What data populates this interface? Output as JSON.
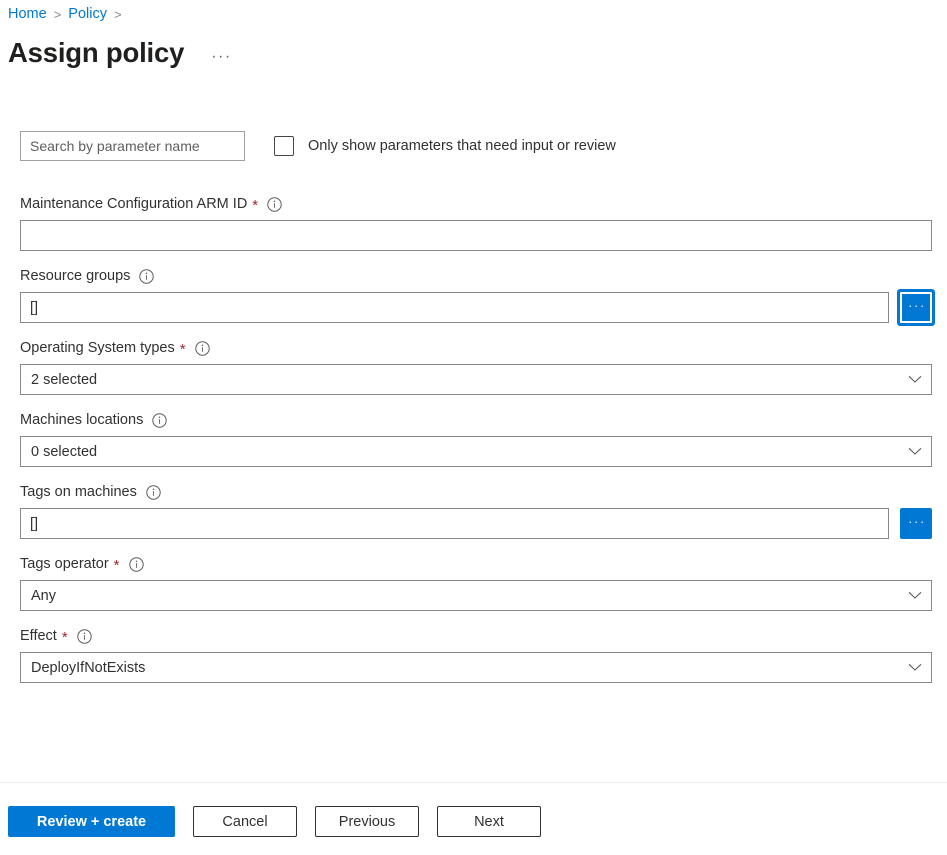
{
  "breadcrumb": {
    "items": [
      {
        "label": "Home"
      },
      {
        "label": "Policy"
      }
    ],
    "separator": ">"
  },
  "header": {
    "title": "Assign policy",
    "more_menu": "···"
  },
  "filters": {
    "search_placeholder": "Search by parameter name",
    "search_value": "",
    "checkbox_label": "Only show parameters that need input or review",
    "checkbox_checked": false
  },
  "parameters": [
    {
      "label": "Maintenance Configuration ARM ID",
      "required": true,
      "info": true,
      "control": "text",
      "value": "",
      "picker": false
    },
    {
      "label": "Resource groups",
      "required": false,
      "info": true,
      "control": "text",
      "value": "[]",
      "picker": true,
      "picker_label": "···",
      "picker_focused": true
    },
    {
      "label": "Operating System types",
      "required": true,
      "info": true,
      "control": "dropdown",
      "value": "2 selected"
    },
    {
      "label": "Machines locations",
      "required": false,
      "info": true,
      "control": "dropdown",
      "value": "0 selected"
    },
    {
      "label": "Tags on machines",
      "required": false,
      "info": true,
      "control": "text",
      "value": "[]",
      "picker": true,
      "picker_label": "···",
      "picker_focused": false
    },
    {
      "label": "Tags operator",
      "required": true,
      "info": true,
      "control": "dropdown",
      "value": "Any"
    },
    {
      "label": "Effect",
      "required": true,
      "info": true,
      "control": "dropdown",
      "value": "DeployIfNotExists"
    }
  ],
  "footer": {
    "review_create": "Review + create",
    "cancel": "Cancel",
    "previous": "Previous",
    "next": "Next"
  },
  "colors": {
    "accent": "#0078d4",
    "link": "#0078d4",
    "required_star": "#a4262c",
    "text": "#323130",
    "border": "#8a8886"
  },
  "icons": {
    "info": "info-icon",
    "chevron": "chevron-down-icon",
    "separator": "chevron-right-icon"
  }
}
